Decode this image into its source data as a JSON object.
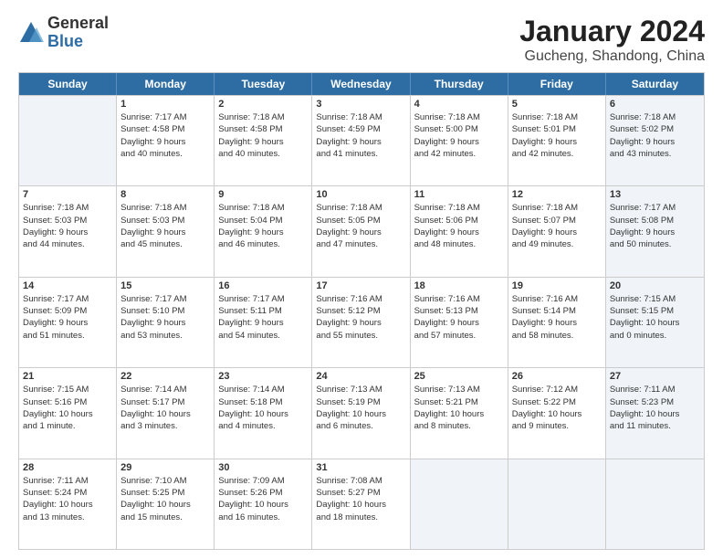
{
  "logo": {
    "general": "General",
    "blue": "Blue"
  },
  "title": {
    "month": "January 2024",
    "location": "Gucheng, Shandong, China"
  },
  "header_days": [
    "Sunday",
    "Monday",
    "Tuesday",
    "Wednesday",
    "Thursday",
    "Friday",
    "Saturday"
  ],
  "weeks": [
    [
      {
        "day": "",
        "shade": true,
        "lines": []
      },
      {
        "day": "1",
        "shade": false,
        "lines": [
          "Sunrise: 7:17 AM",
          "Sunset: 4:58 PM",
          "Daylight: 9 hours",
          "and 40 minutes."
        ]
      },
      {
        "day": "2",
        "shade": false,
        "lines": [
          "Sunrise: 7:18 AM",
          "Sunset: 4:58 PM",
          "Daylight: 9 hours",
          "and 40 minutes."
        ]
      },
      {
        "day": "3",
        "shade": false,
        "lines": [
          "Sunrise: 7:18 AM",
          "Sunset: 4:59 PM",
          "Daylight: 9 hours",
          "and 41 minutes."
        ]
      },
      {
        "day": "4",
        "shade": false,
        "lines": [
          "Sunrise: 7:18 AM",
          "Sunset: 5:00 PM",
          "Daylight: 9 hours",
          "and 42 minutes."
        ]
      },
      {
        "day": "5",
        "shade": false,
        "lines": [
          "Sunrise: 7:18 AM",
          "Sunset: 5:01 PM",
          "Daylight: 9 hours",
          "and 42 minutes."
        ]
      },
      {
        "day": "6",
        "shade": true,
        "lines": [
          "Sunrise: 7:18 AM",
          "Sunset: 5:02 PM",
          "Daylight: 9 hours",
          "and 43 minutes."
        ]
      }
    ],
    [
      {
        "day": "7",
        "shade": false,
        "lines": [
          "Sunrise: 7:18 AM",
          "Sunset: 5:03 PM",
          "Daylight: 9 hours",
          "and 44 minutes."
        ]
      },
      {
        "day": "8",
        "shade": false,
        "lines": [
          "Sunrise: 7:18 AM",
          "Sunset: 5:03 PM",
          "Daylight: 9 hours",
          "and 45 minutes."
        ]
      },
      {
        "day": "9",
        "shade": false,
        "lines": [
          "Sunrise: 7:18 AM",
          "Sunset: 5:04 PM",
          "Daylight: 9 hours",
          "and 46 minutes."
        ]
      },
      {
        "day": "10",
        "shade": false,
        "lines": [
          "Sunrise: 7:18 AM",
          "Sunset: 5:05 PM",
          "Daylight: 9 hours",
          "and 47 minutes."
        ]
      },
      {
        "day": "11",
        "shade": false,
        "lines": [
          "Sunrise: 7:18 AM",
          "Sunset: 5:06 PM",
          "Daylight: 9 hours",
          "and 48 minutes."
        ]
      },
      {
        "day": "12",
        "shade": false,
        "lines": [
          "Sunrise: 7:18 AM",
          "Sunset: 5:07 PM",
          "Daylight: 9 hours",
          "and 49 minutes."
        ]
      },
      {
        "day": "13",
        "shade": true,
        "lines": [
          "Sunrise: 7:17 AM",
          "Sunset: 5:08 PM",
          "Daylight: 9 hours",
          "and 50 minutes."
        ]
      }
    ],
    [
      {
        "day": "14",
        "shade": false,
        "lines": [
          "Sunrise: 7:17 AM",
          "Sunset: 5:09 PM",
          "Daylight: 9 hours",
          "and 51 minutes."
        ]
      },
      {
        "day": "15",
        "shade": false,
        "lines": [
          "Sunrise: 7:17 AM",
          "Sunset: 5:10 PM",
          "Daylight: 9 hours",
          "and 53 minutes."
        ]
      },
      {
        "day": "16",
        "shade": false,
        "lines": [
          "Sunrise: 7:17 AM",
          "Sunset: 5:11 PM",
          "Daylight: 9 hours",
          "and 54 minutes."
        ]
      },
      {
        "day": "17",
        "shade": false,
        "lines": [
          "Sunrise: 7:16 AM",
          "Sunset: 5:12 PM",
          "Daylight: 9 hours",
          "and 55 minutes."
        ]
      },
      {
        "day": "18",
        "shade": false,
        "lines": [
          "Sunrise: 7:16 AM",
          "Sunset: 5:13 PM",
          "Daylight: 9 hours",
          "and 57 minutes."
        ]
      },
      {
        "day": "19",
        "shade": false,
        "lines": [
          "Sunrise: 7:16 AM",
          "Sunset: 5:14 PM",
          "Daylight: 9 hours",
          "and 58 minutes."
        ]
      },
      {
        "day": "20",
        "shade": true,
        "lines": [
          "Sunrise: 7:15 AM",
          "Sunset: 5:15 PM",
          "Daylight: 10 hours",
          "and 0 minutes."
        ]
      }
    ],
    [
      {
        "day": "21",
        "shade": false,
        "lines": [
          "Sunrise: 7:15 AM",
          "Sunset: 5:16 PM",
          "Daylight: 10 hours",
          "and 1 minute."
        ]
      },
      {
        "day": "22",
        "shade": false,
        "lines": [
          "Sunrise: 7:14 AM",
          "Sunset: 5:17 PM",
          "Daylight: 10 hours",
          "and 3 minutes."
        ]
      },
      {
        "day": "23",
        "shade": false,
        "lines": [
          "Sunrise: 7:14 AM",
          "Sunset: 5:18 PM",
          "Daylight: 10 hours",
          "and 4 minutes."
        ]
      },
      {
        "day": "24",
        "shade": false,
        "lines": [
          "Sunrise: 7:13 AM",
          "Sunset: 5:19 PM",
          "Daylight: 10 hours",
          "and 6 minutes."
        ]
      },
      {
        "day": "25",
        "shade": false,
        "lines": [
          "Sunrise: 7:13 AM",
          "Sunset: 5:21 PM",
          "Daylight: 10 hours",
          "and 8 minutes."
        ]
      },
      {
        "day": "26",
        "shade": false,
        "lines": [
          "Sunrise: 7:12 AM",
          "Sunset: 5:22 PM",
          "Daylight: 10 hours",
          "and 9 minutes."
        ]
      },
      {
        "day": "27",
        "shade": true,
        "lines": [
          "Sunrise: 7:11 AM",
          "Sunset: 5:23 PM",
          "Daylight: 10 hours",
          "and 11 minutes."
        ]
      }
    ],
    [
      {
        "day": "28",
        "shade": false,
        "lines": [
          "Sunrise: 7:11 AM",
          "Sunset: 5:24 PM",
          "Daylight: 10 hours",
          "and 13 minutes."
        ]
      },
      {
        "day": "29",
        "shade": false,
        "lines": [
          "Sunrise: 7:10 AM",
          "Sunset: 5:25 PM",
          "Daylight: 10 hours",
          "and 15 minutes."
        ]
      },
      {
        "day": "30",
        "shade": false,
        "lines": [
          "Sunrise: 7:09 AM",
          "Sunset: 5:26 PM",
          "Daylight: 10 hours",
          "and 16 minutes."
        ]
      },
      {
        "day": "31",
        "shade": false,
        "lines": [
          "Sunrise: 7:08 AM",
          "Sunset: 5:27 PM",
          "Daylight: 10 hours",
          "and 18 minutes."
        ]
      },
      {
        "day": "",
        "shade": true,
        "lines": []
      },
      {
        "day": "",
        "shade": true,
        "lines": []
      },
      {
        "day": "",
        "shade": true,
        "lines": []
      }
    ]
  ]
}
